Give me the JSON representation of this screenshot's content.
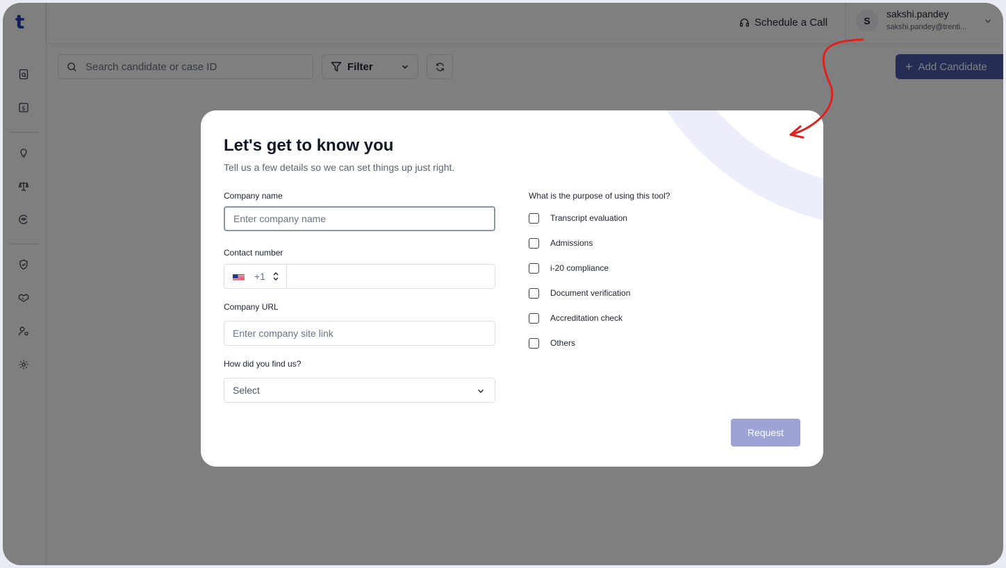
{
  "sidebar": {
    "logo": "t",
    "icons": [
      "document-search-icon",
      "invoice-icon",
      "lightbulb-icon",
      "scales-icon",
      "graduation-icon",
      "shield-check-icon",
      "handshake-icon",
      "user-settings-icon",
      "gear-icon"
    ]
  },
  "topbar": {
    "schedule_label": "Schedule a Call",
    "user": {
      "initial": "S",
      "name": "sakshi.pandey",
      "email": "sakshi.pandey@trenti..."
    }
  },
  "toolbar": {
    "search_placeholder": "Search candidate or case ID",
    "filter_label": "Filter",
    "add_label": "Add Candidate"
  },
  "modal": {
    "title": "Let's get to know you",
    "subtitle": "Tell us a few details so we can set things up just right.",
    "company_name_label": "Company name",
    "company_name_placeholder": "Enter company name",
    "contact_label": "Contact number",
    "country_code": "+1",
    "company_url_label": "Company URL",
    "company_url_placeholder": "Enter company site link",
    "find_us_label": "How did you find us?",
    "find_us_value": "Select",
    "purpose_label": "What is the purpose of using this tool?",
    "purposes": [
      "Transcript evaluation",
      "Admissions",
      "i-20 compliance",
      "Document verification",
      "Accreditation check",
      "Others"
    ],
    "request_label": "Request"
  },
  "colors": {
    "brand": "#1f3fb8",
    "request_button": "#9ea3d6",
    "annotation_arrow": "#e0201d",
    "overlay": "rgba(0,0,0,0.5)"
  }
}
